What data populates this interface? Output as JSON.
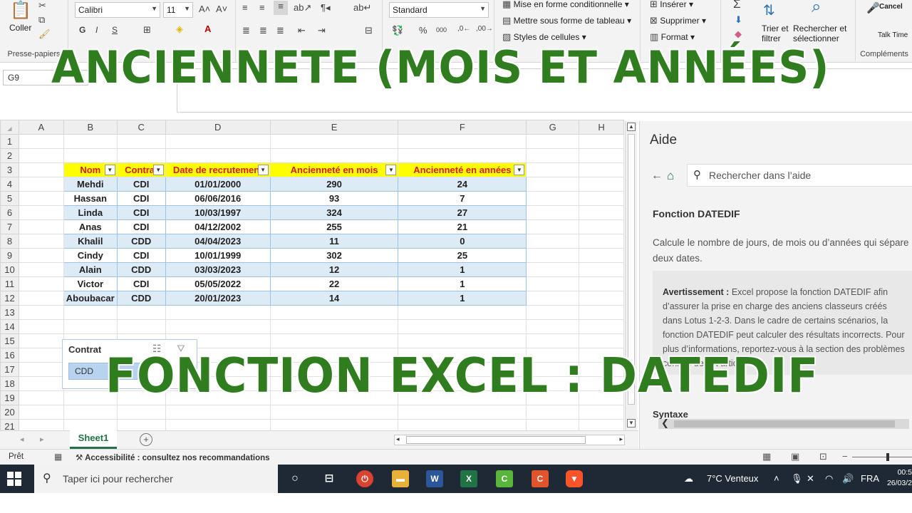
{
  "ribbon": {
    "paste_label": "Coller",
    "clipboard_group": "Presse-papiers",
    "font_name": "Calibri",
    "font_size": "11",
    "number_format": "Standard",
    "cond_format": "Mise en forme conditionnelle",
    "table_format": "Mettre sous forme de tableau",
    "cell_styles": "Styles de cellules",
    "insert": "Insérer",
    "delete": "Supprimer",
    "format": "Format",
    "sort_filter_1": "Trier et",
    "sort_filter_2": "filtrer",
    "find_select_1": "Rechercher et",
    "find_select_2": "sélectionner",
    "cancel_label": "Cancel",
    "talk_time": "Talk Time",
    "addins_group": "Compléments",
    "bold_label": "G",
    "italic_label": "I",
    "underline_label": "S",
    "percent": "%",
    "thousands": "000",
    "sigma": "Σ"
  },
  "namebox": "G9",
  "columns": [
    "A",
    "B",
    "C",
    "D",
    "E",
    "F",
    "G",
    "H"
  ],
  "rows": [
    "1",
    "2",
    "3",
    "4",
    "5",
    "6",
    "7",
    "8",
    "9",
    "10",
    "11",
    "12",
    "13",
    "14",
    "15",
    "16",
    "17",
    "18",
    "19",
    "20",
    "21"
  ],
  "table": {
    "headers": [
      "Nom",
      "Contrat",
      "Date de recrutement",
      "Ancienneté en mois",
      "Ancienneté en années"
    ],
    "rows": [
      [
        "Mehdi",
        "CDI",
        "01/01/2000",
        "290",
        "24"
      ],
      [
        "Hassan",
        "CDI",
        "06/06/2016",
        "93",
        "7"
      ],
      [
        "Linda",
        "CDI",
        "10/03/1997",
        "324",
        "27"
      ],
      [
        "Anas",
        "CDI",
        "04/12/2002",
        "255",
        "21"
      ],
      [
        "Khalil",
        "CDD",
        "04/04/2023",
        "11",
        "0"
      ],
      [
        "Cindy",
        "CDI",
        "10/01/1999",
        "302",
        "25"
      ],
      [
        "Alain",
        "CDD",
        "03/03/2023",
        "12",
        "1"
      ],
      [
        "Victor",
        "CDI",
        "05/05/2022",
        "22",
        "1"
      ],
      [
        "Aboubacar",
        "CDD",
        "20/01/2023",
        "14",
        "1"
      ]
    ]
  },
  "slicer": {
    "title": "Contrat",
    "item": "CDD"
  },
  "sheet_tab": "Sheet1",
  "help": {
    "title": "Aide",
    "search_placeholder": "Rechercher dans l’aide",
    "article_title": "Fonction DATEDIF",
    "article_desc": "Calcule le nombre de jours, de mois ou d’années qui sépare deux dates.",
    "warning_label": "Avertissement :",
    "warning_text": "Excel propose la fonction DATEDIF afin d’assurer la prise en charge des anciens classeurs créés dans Lotus 1-2-3. Dans le cadre de certains scénarios, la fonction DATEDIF peut calculer des résultats incorrects. Pour plus d’informations, reportez-vous à la section des problèmes connus de cet article.",
    "syntax": "Syntaxe"
  },
  "status": {
    "ready": "Prêt",
    "accessibility": "Accessibilité : consultez nos recommandations"
  },
  "taskbar": {
    "search_placeholder": "Taper ici pour rechercher",
    "weather": "7°C Venteux",
    "lang": "FRA",
    "time": "00:5",
    "date": "26/03/2"
  },
  "overlay": {
    "title_top": "ANCIENNETE (MOIS ET ANNÉES)",
    "title_bottom": "FONCTION EXCEL : DATEDIF"
  },
  "colors": {
    "overlay_green": "#2f7d1f",
    "header_fill": "#ffff00",
    "header_text": "#d91a1a",
    "band_fill": "#ddebf7",
    "excel_green": "#217346"
  }
}
